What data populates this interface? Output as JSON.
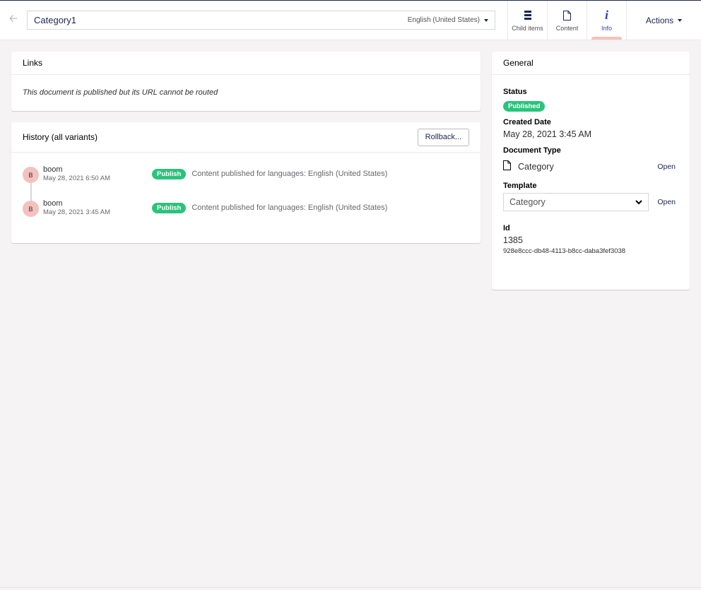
{
  "header": {
    "name_value": "Category1",
    "language": "English (United States)",
    "apps": [
      {
        "label": "Child items",
        "icon": "list-icon"
      },
      {
        "label": "Content",
        "icon": "document-icon"
      },
      {
        "label": "Info",
        "icon": "info-icon",
        "active": true
      }
    ],
    "actions_label": "Actions"
  },
  "links": {
    "title": "Links",
    "message": "This document is published but its URL cannot be routed"
  },
  "history": {
    "title": "History (all variants)",
    "rollback_label": "Rollback...",
    "entries": [
      {
        "avatar": "B",
        "user": "boom",
        "date": "May 28, 2021 6:50 AM",
        "badge": "Publish",
        "message": "Content published for languages: English (United States)"
      },
      {
        "avatar": "B",
        "user": "boom",
        "date": "May 28, 2021 3:45 AM",
        "badge": "Publish",
        "message": "Content published for languages: English (United States)"
      }
    ]
  },
  "general": {
    "title": "General",
    "status_label": "Status",
    "status_value": "Published",
    "created_label": "Created Date",
    "created_value": "May 28, 2021 3:45 AM",
    "doctype_label": "Document Type",
    "doctype_value": "Category",
    "open_label": "Open",
    "template_label": "Template",
    "template_value": "Category",
    "id_label": "Id",
    "id_value": "1385",
    "guid_value": "928e8ccc-db48-4113-b8cc-daba3fef3038"
  },
  "colors": {
    "accent": "#1b264f",
    "active_tab": "#3544b1",
    "published_green": "#2bc37c",
    "avatar_bg": "#f5c1bc"
  }
}
